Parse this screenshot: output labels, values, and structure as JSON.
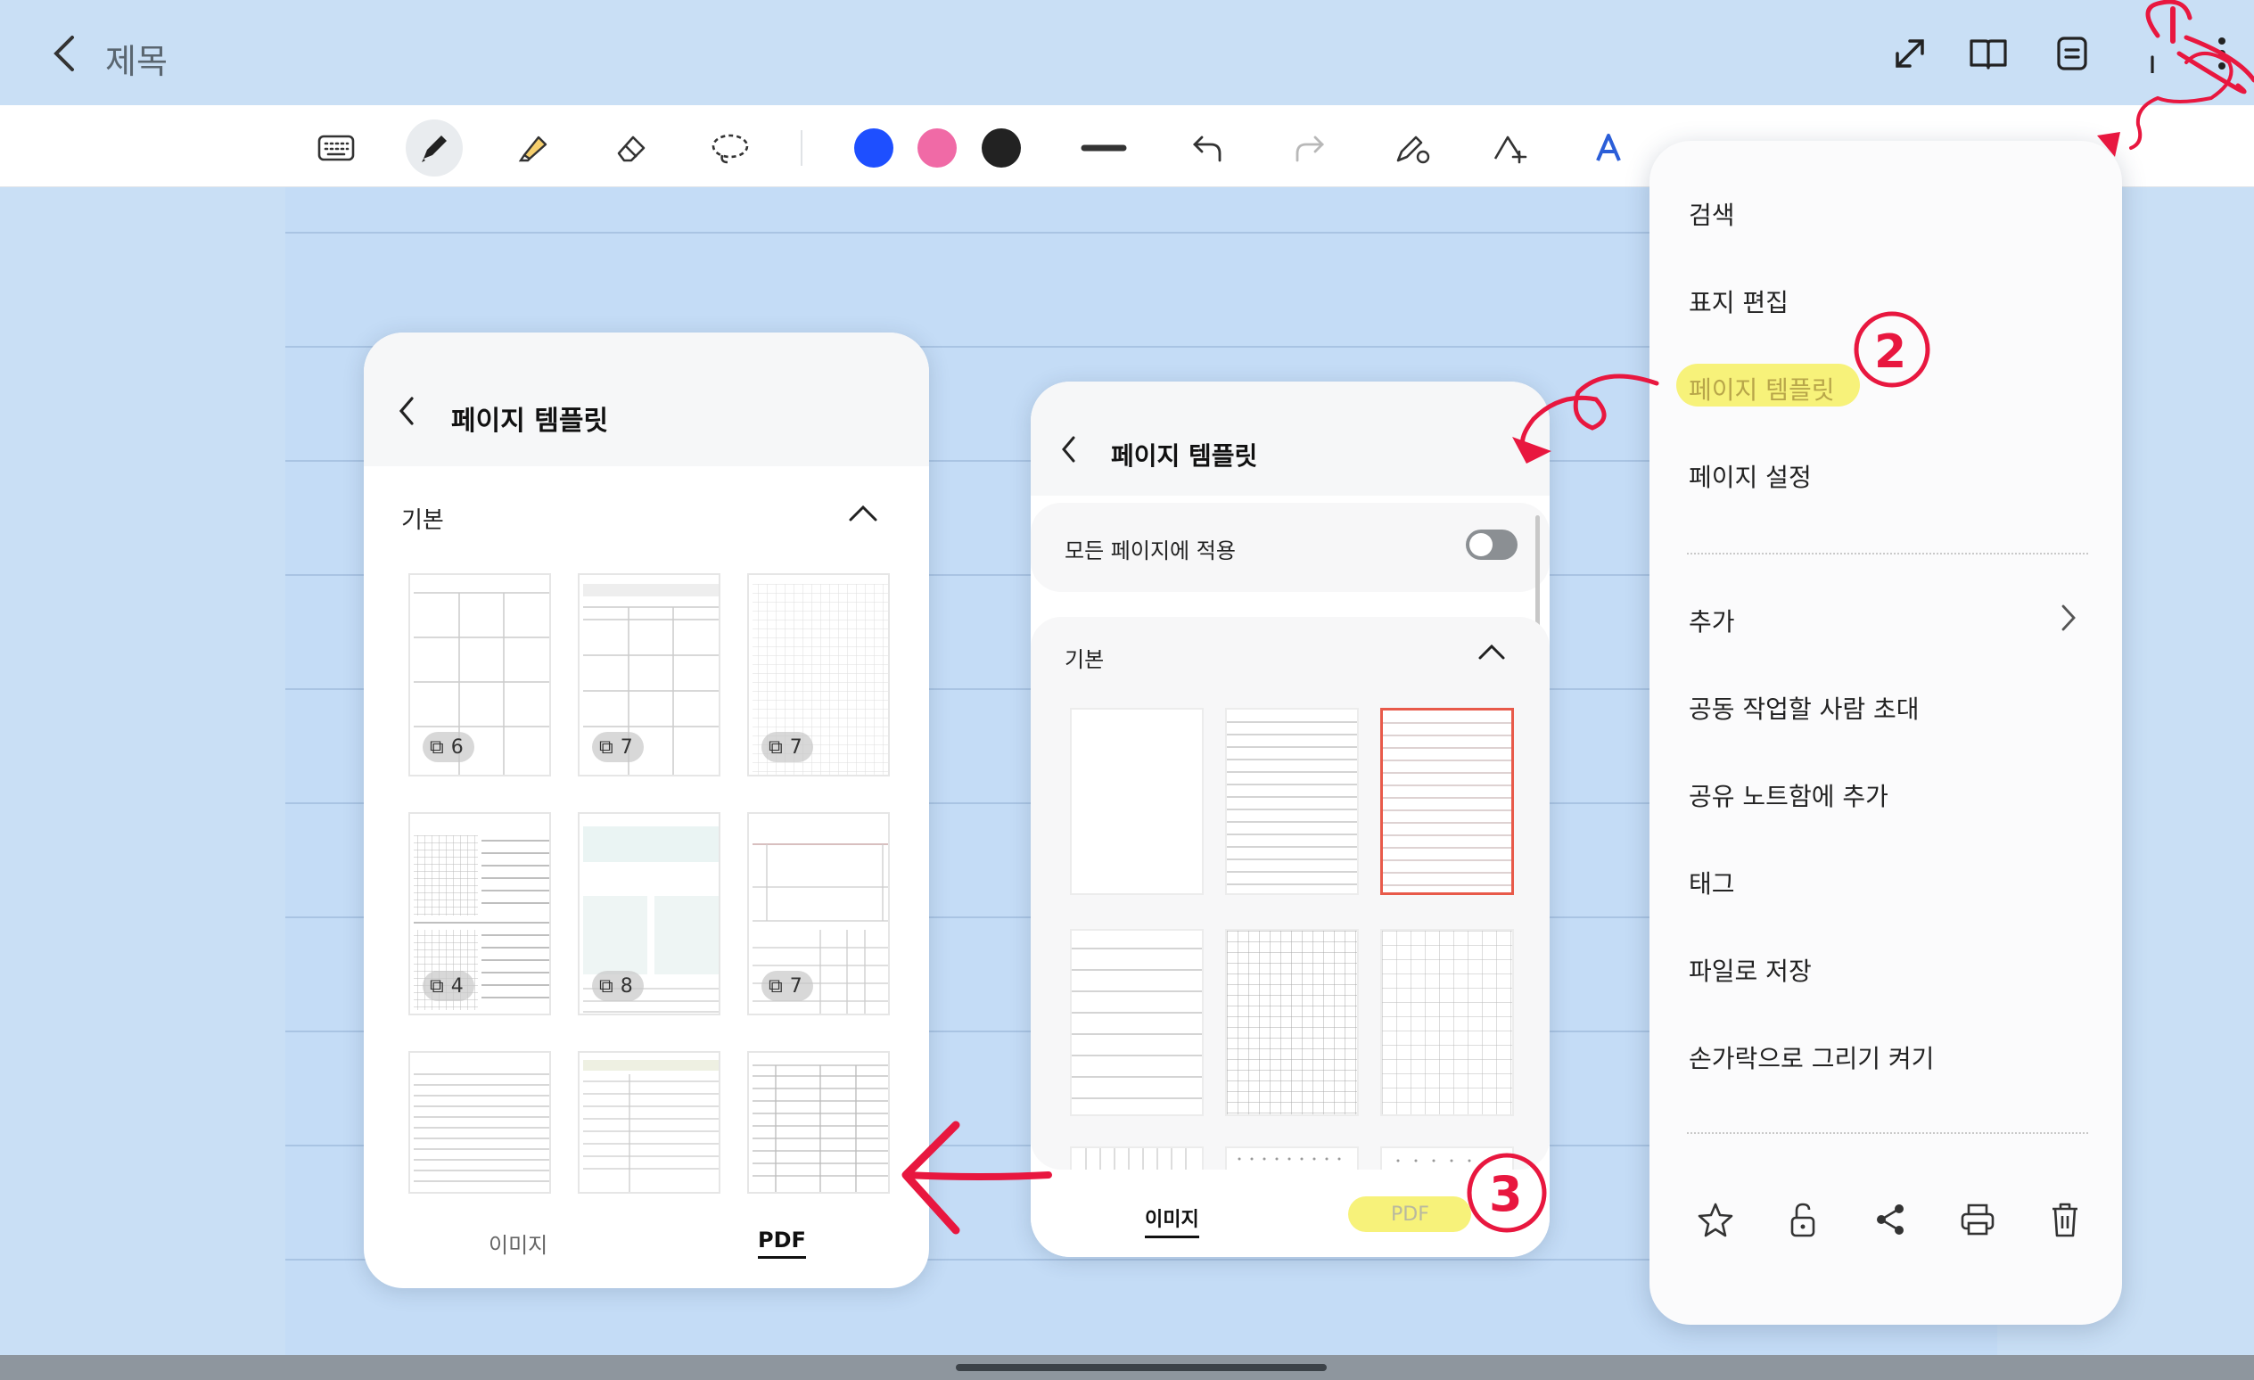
{
  "header": {
    "title": "제목",
    "icons": [
      "back-icon",
      "expand-icon",
      "book-icon",
      "page-list-icon",
      "add-icon",
      "more-icon"
    ]
  },
  "toolbar": {
    "tools": [
      "keyboard-icon",
      "pen-icon",
      "highlighter-icon",
      "eraser-icon",
      "lasso-icon"
    ],
    "colors": [
      "#1e4fff",
      "#f06aa6",
      "#222222"
    ],
    "actions": [
      "stroke-width-icon",
      "undo-icon",
      "redo-icon",
      "pen-settings-icon",
      "shape-icon",
      "text-style-icon"
    ]
  },
  "panel_pdf": {
    "title": "페이지 템플릿",
    "section": "기본",
    "badges": [
      "6",
      "7",
      "7",
      "4",
      "8",
      "7"
    ],
    "tabs": [
      "이미지",
      "PDF"
    ],
    "selected_tab": "PDF"
  },
  "panel_image": {
    "title": "페이지 템플릿",
    "apply_all_label": "모든 페이지에 적용",
    "apply_all_on": false,
    "section": "기본",
    "tabs": [
      "이미지",
      "PDF"
    ],
    "selected_tab": "이미지"
  },
  "menu": {
    "items": [
      "검색",
      "표지 편집",
      "페이지 템플릿",
      "페이지 설정"
    ],
    "items2": [
      "추가",
      "공동 작업할 사람 초대",
      "공유 노트함에 추가",
      "태그",
      "파일로 저장",
      "손가락으로 그리기 켜기"
    ],
    "highlighted": "페이지 템플릿",
    "bottom_icons": [
      "star-icon",
      "unlock-icon",
      "share-icon",
      "print-icon",
      "trash-icon"
    ]
  },
  "annotations": {
    "steps": [
      "1",
      "2",
      "3"
    ],
    "highlight_color": "#f7f27a",
    "arrow_color": "#e8173f"
  }
}
